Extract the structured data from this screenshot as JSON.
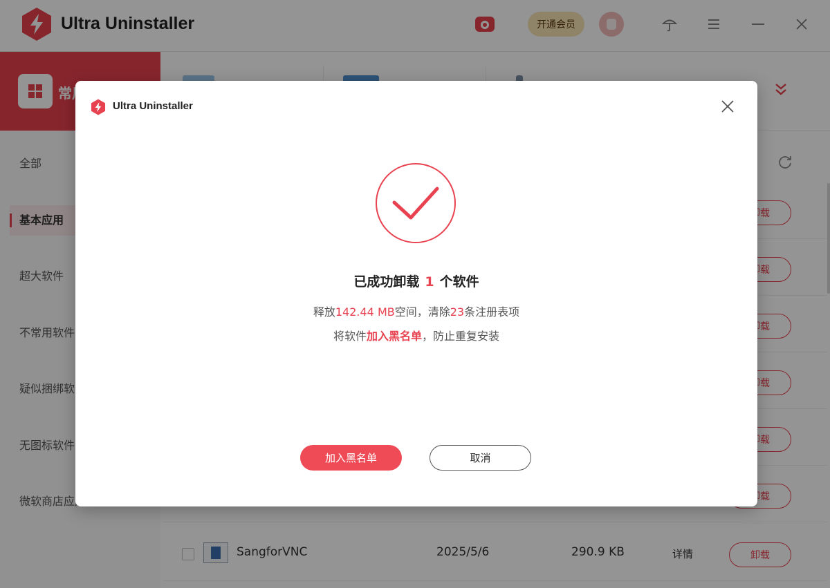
{
  "app": {
    "title": "Ultra Uninstaller",
    "vip_label": "开通会员"
  },
  "colors": {
    "accent": "#e8414f",
    "vip_bg": "#f7e2b4"
  },
  "titlebar_icons": [
    "toolbox-icon",
    "skin-icon",
    "menu-icon",
    "minimize-icon",
    "close-icon"
  ],
  "sidebar": {
    "header_label": "常用",
    "items": [
      {
        "label": "全部"
      },
      {
        "label": "基本应用"
      },
      {
        "label": "超大软件"
      },
      {
        "label": "不常用软件"
      },
      {
        "label": "疑似捆绑软件"
      },
      {
        "label": "无图标软件"
      },
      {
        "label": "微软商店应用"
      }
    ],
    "active_index": 1
  },
  "list": {
    "uninstall_label": "卸载",
    "detail_label": "详情",
    "last_row": {
      "name": "SangforVNC",
      "date": "2025/5/6",
      "size": "290.9 KB"
    }
  },
  "dialog": {
    "title": "Ultra Uninstaller",
    "success_prefix": "已成功卸载",
    "success_count": "1",
    "success_suffix": "个软件",
    "freed_prefix": "释放",
    "freed_value": "142.44 MB",
    "freed_middle": "空间，清除",
    "registry_count": "23",
    "freed_suffix": "条注册表项",
    "blacklist_prefix": "将软件",
    "blacklist_link": "加入黑名单",
    "blacklist_suffix": "，防止重复安装",
    "primary_button": "加入黑名单",
    "secondary_button": "取消"
  }
}
